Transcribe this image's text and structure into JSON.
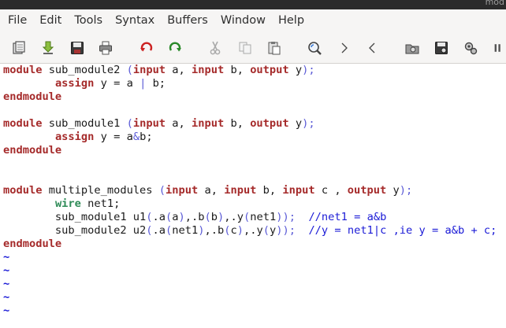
{
  "window": {
    "title": "mod"
  },
  "menu": {
    "items": [
      "File",
      "Edit",
      "Tools",
      "Syntax",
      "Buffers",
      "Window",
      "Help"
    ]
  },
  "toolbar": {
    "icons": [
      "open-icon",
      "download-icon",
      "save-icon",
      "print-icon",
      "undo-icon",
      "redo-icon",
      "cut-icon",
      "copy-icon",
      "paste-icon",
      "find-icon",
      "forward-icon",
      "back-icon",
      "load-session-icon",
      "save-session-icon",
      "run-script-icon"
    ]
  },
  "colors": {
    "keyword": "#a52a2a",
    "type_keyword": "#2e8b57",
    "comment": "#1a1ad6",
    "text": "#1a1a1a",
    "tilde": "#1a1ad6"
  },
  "code": {
    "lines": [
      [
        {
          "t": "module",
          "c": "kw"
        },
        {
          "t": " sub_module2 ",
          "c": ""
        },
        {
          "t": "(",
          "c": "pr"
        },
        {
          "t": "input",
          "c": "kw"
        },
        {
          "t": " a, ",
          "c": ""
        },
        {
          "t": "input",
          "c": "kw"
        },
        {
          "t": " b, ",
          "c": ""
        },
        {
          "t": "output",
          "c": "kw"
        },
        {
          "t": " y",
          "c": ""
        },
        {
          "t": ");",
          "c": "pr"
        }
      ],
      [
        {
          "t": "        ",
          "c": ""
        },
        {
          "t": "assign",
          "c": "kw"
        },
        {
          "t": " y = a ",
          "c": ""
        },
        {
          "t": "|",
          "c": "pr"
        },
        {
          "t": " b;",
          "c": ""
        }
      ],
      [
        {
          "t": "endmodule",
          "c": "kw"
        }
      ],
      [],
      [
        {
          "t": "module",
          "c": "kw"
        },
        {
          "t": " sub_module1 ",
          "c": ""
        },
        {
          "t": "(",
          "c": "pr"
        },
        {
          "t": "input",
          "c": "kw"
        },
        {
          "t": " a, ",
          "c": ""
        },
        {
          "t": "input",
          "c": "kw"
        },
        {
          "t": " b, ",
          "c": ""
        },
        {
          "t": "output",
          "c": "kw"
        },
        {
          "t": " y",
          "c": ""
        },
        {
          "t": ");",
          "c": "pr"
        }
      ],
      [
        {
          "t": "        ",
          "c": ""
        },
        {
          "t": "assign",
          "c": "kw"
        },
        {
          "t": " y = a",
          "c": ""
        },
        {
          "t": "&",
          "c": "pr"
        },
        {
          "t": "b;",
          "c": ""
        }
      ],
      [
        {
          "t": "endmodule",
          "c": "kw"
        }
      ],
      [],
      [],
      [
        {
          "t": "module",
          "c": "kw"
        },
        {
          "t": " multiple_modules ",
          "c": ""
        },
        {
          "t": "(",
          "c": "pr"
        },
        {
          "t": "input",
          "c": "kw"
        },
        {
          "t": " a, ",
          "c": ""
        },
        {
          "t": "input",
          "c": "kw"
        },
        {
          "t": " b, ",
          "c": ""
        },
        {
          "t": "input",
          "c": "kw"
        },
        {
          "t": " c , ",
          "c": ""
        },
        {
          "t": "output",
          "c": "kw"
        },
        {
          "t": " y",
          "c": ""
        },
        {
          "t": ");",
          "c": "pr"
        }
      ],
      [
        {
          "t": "        ",
          "c": ""
        },
        {
          "t": "wire",
          "c": "tk"
        },
        {
          "t": " net1;",
          "c": ""
        }
      ],
      [
        {
          "t": "        sub_module1 u1",
          "c": ""
        },
        {
          "t": "(",
          "c": "pr"
        },
        {
          "t": ".a",
          "c": ""
        },
        {
          "t": "(",
          "c": "pr"
        },
        {
          "t": "a",
          "c": ""
        },
        {
          "t": ")",
          "c": "pr"
        },
        {
          "t": ",.b",
          "c": ""
        },
        {
          "t": "(",
          "c": "pr"
        },
        {
          "t": "b",
          "c": ""
        },
        {
          "t": ")",
          "c": "pr"
        },
        {
          "t": ",.y",
          "c": ""
        },
        {
          "t": "(",
          "c": "pr"
        },
        {
          "t": "net1",
          "c": ""
        },
        {
          "t": "));",
          "c": "pr"
        },
        {
          "t": "  ",
          "c": ""
        },
        {
          "t": "//net1 = a&b",
          "c": "cm"
        }
      ],
      [
        {
          "t": "        sub_module2 u2",
          "c": ""
        },
        {
          "t": "(",
          "c": "pr"
        },
        {
          "t": ".a",
          "c": ""
        },
        {
          "t": "(",
          "c": "pr"
        },
        {
          "t": "net1",
          "c": ""
        },
        {
          "t": ")",
          "c": "pr"
        },
        {
          "t": ",.b",
          "c": ""
        },
        {
          "t": "(",
          "c": "pr"
        },
        {
          "t": "c",
          "c": ""
        },
        {
          "t": ")",
          "c": "pr"
        },
        {
          "t": ",.y",
          "c": ""
        },
        {
          "t": "(",
          "c": "pr"
        },
        {
          "t": "y",
          "c": ""
        },
        {
          "t": "));",
          "c": "pr"
        },
        {
          "t": "  ",
          "c": ""
        },
        {
          "t": "//y = net1|c ,ie y = a&b + c;",
          "c": "cm"
        }
      ],
      [
        {
          "t": "endmodule",
          "c": "kw"
        }
      ],
      [
        {
          "t": "~",
          "c": "tilde"
        }
      ],
      [
        {
          "t": "~",
          "c": "tilde"
        }
      ],
      [
        {
          "t": "~",
          "c": "tilde"
        }
      ],
      [
        {
          "t": "~",
          "c": "tilde"
        }
      ],
      [
        {
          "t": "~",
          "c": "tilde"
        }
      ]
    ]
  }
}
